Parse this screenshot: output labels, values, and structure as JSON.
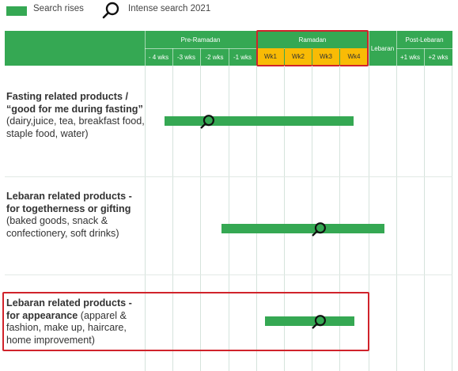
{
  "legend": {
    "search_rises": "Search rises",
    "intense_search": "Intense search 2021",
    "bar_color": "#35a853",
    "icon": "magnifier-icon"
  },
  "header": {
    "pre_ramadan": "Pre-Ramadan",
    "ramadan": "Ramadan",
    "lebaran": "Lebaran",
    "post_lebaran": "Post-Lebaran",
    "pre_weeks": [
      "- 4 wks",
      "-3 wks",
      "-2 wks",
      "-1 wks"
    ],
    "ramadan_weeks": [
      "Wk1",
      "Wk2",
      "Wk3",
      "Wk4"
    ],
    "post_weeks": [
      "+1 wks",
      "+2 wks"
    ],
    "header_color": "#35a853",
    "ramadan_week_color": "#f9bb05",
    "highlight_color": "#d0232b"
  },
  "rows": [
    {
      "bold": "Fasting related products / “good for me during fasting”",
      "normal": " (dairy,juice, tea, breakfast food, staple food, water)",
      "highlighted": false
    },
    {
      "bold": "Lebaran related products - for togetherness or gifting",
      "normal": " (baked goods, snack & confectionery, soft drinks)",
      "highlighted": false
    },
    {
      "bold": "Lebaran related products - for appearance",
      "normal": " (apparel & fashion, make up, haircare, home improvement)",
      "highlighted": true
    }
  ]
}
